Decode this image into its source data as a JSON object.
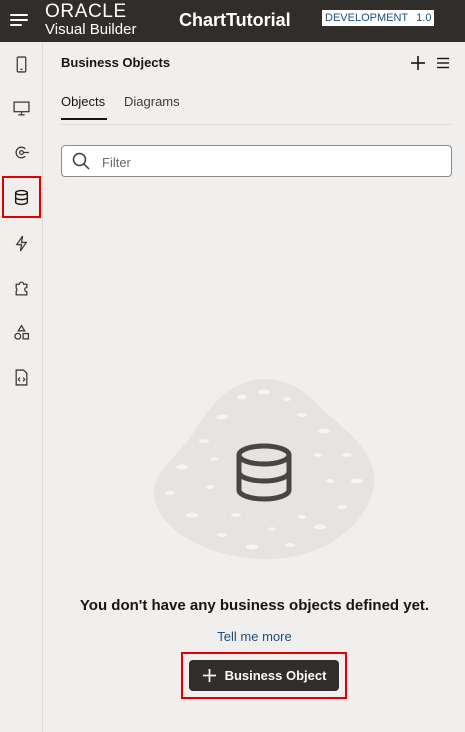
{
  "header": {
    "menu_icon": "hamburger-icon",
    "brand_company": "ORACLE",
    "brand_product": "Visual Builder",
    "app_title": "ChartTutorial",
    "environment": "DEVELOPMENT",
    "version": "1.0",
    "background_color": "#312d2a"
  },
  "rail": {
    "items": [
      {
        "name": "mobile-apps",
        "icon": "mobile-phone-icon",
        "selected": false
      },
      {
        "name": "web-apps",
        "icon": "desktop-monitor-icon",
        "selected": false
      },
      {
        "name": "services",
        "icon": "services-connector-icon",
        "selected": false
      },
      {
        "name": "business-objects",
        "icon": "database-icon",
        "selected": true
      },
      {
        "name": "processes",
        "icon": "lightning-bolt-icon",
        "selected": false
      },
      {
        "name": "components",
        "icon": "puzzle-piece-icon",
        "selected": false
      },
      {
        "name": "layouts",
        "icon": "shapes-icon",
        "selected": false
      },
      {
        "name": "source",
        "icon": "code-file-icon",
        "selected": false
      }
    ]
  },
  "panel": {
    "title": "Business Objects",
    "tabs": [
      {
        "label": "Objects",
        "active": true
      },
      {
        "label": "Diagrams",
        "active": false
      }
    ],
    "filter_placeholder": "Filter",
    "filter_value": "",
    "empty_message": "You don't have any business objects defined yet.",
    "tell_me_more": "Tell me more",
    "add_button_label": "Business Object"
  },
  "colors": {
    "highlight": "#e00000",
    "link": "#1d4f7c",
    "button": "#312d2a",
    "background": "#f1efed"
  }
}
